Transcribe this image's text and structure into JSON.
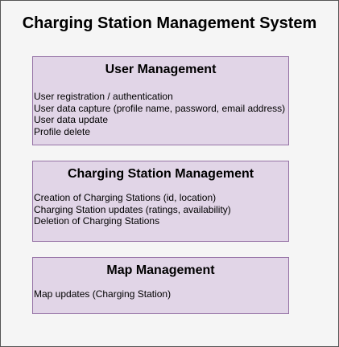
{
  "title": "Charging Station Management System",
  "modules": [
    {
      "name": "User Management",
      "items": [
        "User registration / authentication",
        "User data capture (profile name, password, email address)",
        "User data update",
        "Profile delete"
      ]
    },
    {
      "name": "Charging Station Management",
      "items": [
        "Creation of Charging Stations (id, location)",
        "Charging Station updates (ratings, availability)",
        "Deletion of Charging Stations"
      ]
    },
    {
      "name": "Map Management",
      "items": [
        "Map updates (Charging Station)"
      ]
    }
  ],
  "colors": {
    "frame_background": "#f5f5f5",
    "frame_border": "#555555",
    "module_fill": "#e1d5e7",
    "module_border": "#9673a6"
  }
}
